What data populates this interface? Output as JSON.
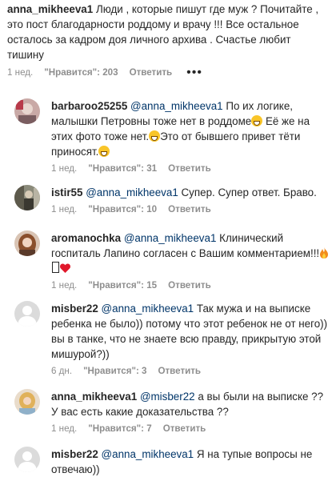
{
  "top_comment": {
    "username": "anna_mikheeva1",
    "text": "Люди , которые пишут где муж ? Почитайте , это пост благодарности роддому и врачу !!! Все остальное осталось за кадром доя личного архива . Счастье любит тишину",
    "time": "1 нед.",
    "likes": "\"Нравится\": 203",
    "reply": "Ответить",
    "more_icon": "more-dots-icon"
  },
  "replies": [
    {
      "username": "barbaroo25255",
      "mention": "@anna_mikheeva1",
      "text_a": "По их логике, малышки Петровны тоже нет в роддоме",
      "text_b": "Её же на этих фото тоже нет.",
      "text_c": "Это от бывшего привет тёти приносят.",
      "time": "1 нед.",
      "likes": "\"Нравится\": 31",
      "reply": "Ответить"
    },
    {
      "username": "istir55",
      "mention": "@anna_mikheeva1",
      "text": "Супер. Супер ответ. Браво.",
      "time": "1 нед.",
      "likes": "\"Нравится\": 10",
      "reply": "Ответить"
    },
    {
      "username": "aromanochka",
      "mention": "@anna_mikheeva1",
      "text": "Клинический госпиталь Лапино согласен с Вашим комментарием!!!",
      "time": "1 нед.",
      "likes": "\"Нравится\": 15",
      "reply": "Ответить"
    },
    {
      "username": "misber22",
      "mention": "@anna_mikheeva1",
      "text": "Так мужа и на выписке ребенка не было)) потому что этот ребенок не от него)) вы в танке, что не знаете всю правду, прикрытую этой мишурой?))",
      "time": "6 дн.",
      "likes": "\"Нравится\": 3",
      "reply": "Ответить"
    },
    {
      "username": "anna_mikheeva1",
      "mention": "@misber22",
      "text": "а вы были на выписке ?? У вас есть какие доказательства ??",
      "time": "1 нед.",
      "likes": "\"Нравится\": 7",
      "reply": "Ответить"
    },
    {
      "username": "misber22",
      "mention": "@anna_mikheeva1",
      "text": "Я на тупые вопросы не отвечаю))",
      "time": "",
      "likes": "",
      "reply": ""
    }
  ]
}
